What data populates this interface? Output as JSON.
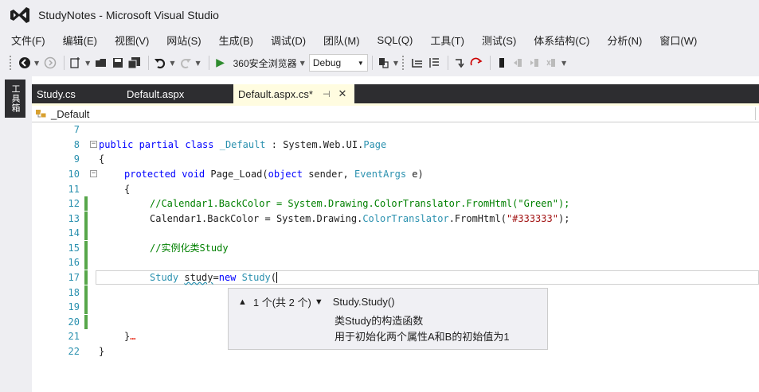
{
  "window": {
    "title": "StudyNotes - Microsoft Visual Studio"
  },
  "menu": [
    "文件(F)",
    "编辑(E)",
    "视图(V)",
    "网站(S)",
    "生成(B)",
    "调试(D)",
    "团队(M)",
    "SQL(Q)",
    "工具(T)",
    "测试(S)",
    "体系结构(C)",
    "分析(N)",
    "窗口(W)"
  ],
  "toolbar": {
    "browser_label": "360安全浏览器",
    "config_value": "Debug"
  },
  "sidebar": {
    "toolbox_label": "工具箱"
  },
  "tabs": [
    {
      "label": "Study.cs"
    },
    {
      "label": "Default.aspx"
    },
    {
      "label": "Default.aspx.cs*",
      "pin": "⊣",
      "close": "✕"
    }
  ],
  "navbar": {
    "class_name": "_Default"
  },
  "editor": {
    "line_numbers": [
      "7",
      "8",
      "9",
      "10",
      "11",
      "12",
      "13",
      "14",
      "15",
      "16",
      "17",
      "18",
      "19",
      "20",
      "21",
      "22"
    ],
    "code": {
      "l8_kw": "public partial class ",
      "l8_cls": "_Default",
      "l8_sep": " : System.Web.UI.",
      "l8_base": "Page",
      "l9": "{",
      "l10_kw": "protected void ",
      "l10_name": "Page_Load(",
      "l10_kw2": "object",
      "l10_p1": " sender, ",
      "l10_ty": "EventArgs",
      "l10_p2": " e)",
      "l11": "{",
      "l12": "//Calendar1.BackColor = System.Drawing.ColorTranslator.FromHtml(\"Green\");",
      "l13_a": "Calendar1.BackColor = System.Drawing.",
      "l13_ty": "ColorTranslator",
      "l13_b": ".FromHtml(",
      "l13_str": "\"#333333\"",
      "l13_c": ");",
      "l15": "//实例化类Study",
      "l17_ty": "Study",
      "l17_var": "study",
      "l17_eq": "=",
      "l17_kw": "new",
      "l17_ty2": "Study",
      "l17_paren": "(",
      "l21": "}",
      "l21_mark": "…",
      "l22": "}"
    }
  },
  "tooltip": {
    "up_arrow": "▲",
    "overload": "1 个(共 2 个)",
    "down_arrow": "▼",
    "signature": "Study.Study()",
    "desc_line1": "类Study的构造函数",
    "desc_line2": "用于初始化两个属性A和B的初始值为1"
  }
}
